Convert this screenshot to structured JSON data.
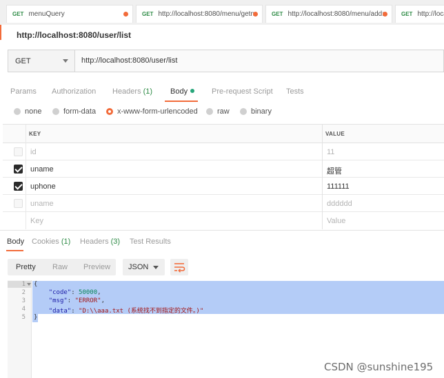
{
  "tabs": [
    {
      "method": "GET",
      "title": "menuQuery",
      "dirty": true
    },
    {
      "method": "GET",
      "title": "http://localhost:8080/menu/getn",
      "dirty": true
    },
    {
      "method": "GET",
      "title": "http://localhost:8080/menu/add:",
      "dirty": true
    },
    {
      "method": "GET",
      "title": "http://localh",
      "dirty": false
    }
  ],
  "request": {
    "title": "http://localhost:8080/user/list",
    "method": "GET",
    "url": "http://localhost:8080/user/list"
  },
  "request_tabs": [
    {
      "label": "Params"
    },
    {
      "label": "Authorization"
    },
    {
      "label": "Headers",
      "count": "(1)"
    },
    {
      "label": "Body"
    },
    {
      "label": "Pre-request Script"
    },
    {
      "label": "Tests"
    }
  ],
  "body_types": [
    "none",
    "form-data",
    "x-www-form-urlencoded",
    "raw",
    "binary"
  ],
  "body_selected": "x-www-form-urlencoded",
  "kv_table": {
    "headers": {
      "key": "KEY",
      "value": "VALUE"
    },
    "rows": [
      {
        "checked": false,
        "key": "id",
        "value": "11"
      },
      {
        "checked": true,
        "key": "uname",
        "value": "超管"
      },
      {
        "checked": true,
        "key": "uphone",
        "value": "111111"
      },
      {
        "checked": false,
        "key": "uname",
        "value": "dddddd"
      }
    ],
    "placeholder": {
      "key": "Key",
      "value": "Value"
    }
  },
  "response_tabs": [
    {
      "label": "Body"
    },
    {
      "label": "Cookies",
      "count": "(1)"
    },
    {
      "label": "Headers",
      "count": "(3)"
    },
    {
      "label": "Test Results"
    }
  ],
  "view_modes": [
    "Pretty",
    "Raw",
    "Preview"
  ],
  "format": "JSON",
  "code": {
    "line_numbers": [
      "1",
      "2",
      "3",
      "4",
      "5"
    ],
    "open_brace": "{",
    "close_brace": "}",
    "fields": [
      {
        "key": "\"code\"",
        "sep": ": ",
        "value": "50000",
        "comma": ",",
        "kind": "num"
      },
      {
        "key": "\"msg\"",
        "sep": ": ",
        "value": "\"ERROR\"",
        "comma": ",",
        "kind": "str"
      },
      {
        "key": "\"data\"",
        "sep": ": ",
        "value": "\"D:\\\\aaa.txt (系统找不到指定的文件。)\"",
        "comma": "",
        "kind": "str"
      }
    ]
  },
  "watermark": "CSDN @sunshine195",
  "colors": {
    "accent": "#f26b3a",
    "method_get": "#2e8b46",
    "selection": "#b4ccf7"
  }
}
